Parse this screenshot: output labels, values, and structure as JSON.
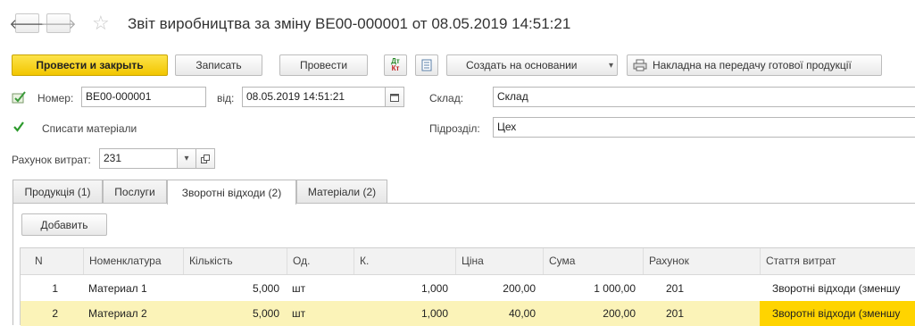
{
  "header": {
    "back_glyph": "🡐",
    "forward_glyph": "🡒",
    "star_glyph": "☆",
    "title": "Звіт виробництва за зміну ВЕ00-000001 от 08.05.2019 14:51:21"
  },
  "toolbar": {
    "post_close": "Провести и закрыть",
    "save": "Записать",
    "post": "Провести",
    "create_based": "Создать на основании",
    "print_invoice": "Накладна на передачу готової продукції",
    "dt_kt_glyph": "Дт",
    "kt_glyph": "Кт",
    "dropdown_glyph": "▾"
  },
  "form": {
    "number_label": "Номер:",
    "number_value": "ВЕ00-000001",
    "date_label": "від:",
    "date_value": "08.05.2019 14:51:21",
    "warehouse_label": "Склад:",
    "warehouse_value": "Склад",
    "writeoff_label": "Списати  матеріали",
    "writeoff_checked": true,
    "division_label": "Підрозділ:",
    "division_value": "Цех",
    "account_label": "Рахунок витрат:",
    "account_value": "231"
  },
  "tabs": [
    {
      "label": "Продукція (1)",
      "active": false
    },
    {
      "label": "Послуги",
      "active": false
    },
    {
      "label": "Зворотні відходи (2)",
      "active": true
    },
    {
      "label": "Матеріали (2)",
      "active": false
    }
  ],
  "table": {
    "add_button": "Добавить",
    "columns": [
      "N",
      "Номенклатура",
      "Кількість",
      "Од.",
      "К.",
      "Ціна",
      "Сума",
      "Рахунок",
      "Стаття витрат"
    ],
    "rows": [
      {
        "n": "1",
        "item": "Материал 1",
        "qty": "5,000",
        "unit": "шт",
        "k": "1,000",
        "price": "200,00",
        "sum": "1 000,00",
        "account": "201",
        "expense": "Зворотні відходи (зменшу",
        "selected": false
      },
      {
        "n": "2",
        "item": "Материал 2",
        "qty": "5,000",
        "unit": "шт",
        "k": "1,000",
        "price": "40,00",
        "sum": "200,00",
        "account": "201",
        "expense": "Зворотні відходи (зменшу",
        "selected": true
      }
    ]
  },
  "colors": {
    "primary_button": "#f2c600",
    "selected_row": "#fbf3b8",
    "selected_cell": "#ffd400"
  }
}
